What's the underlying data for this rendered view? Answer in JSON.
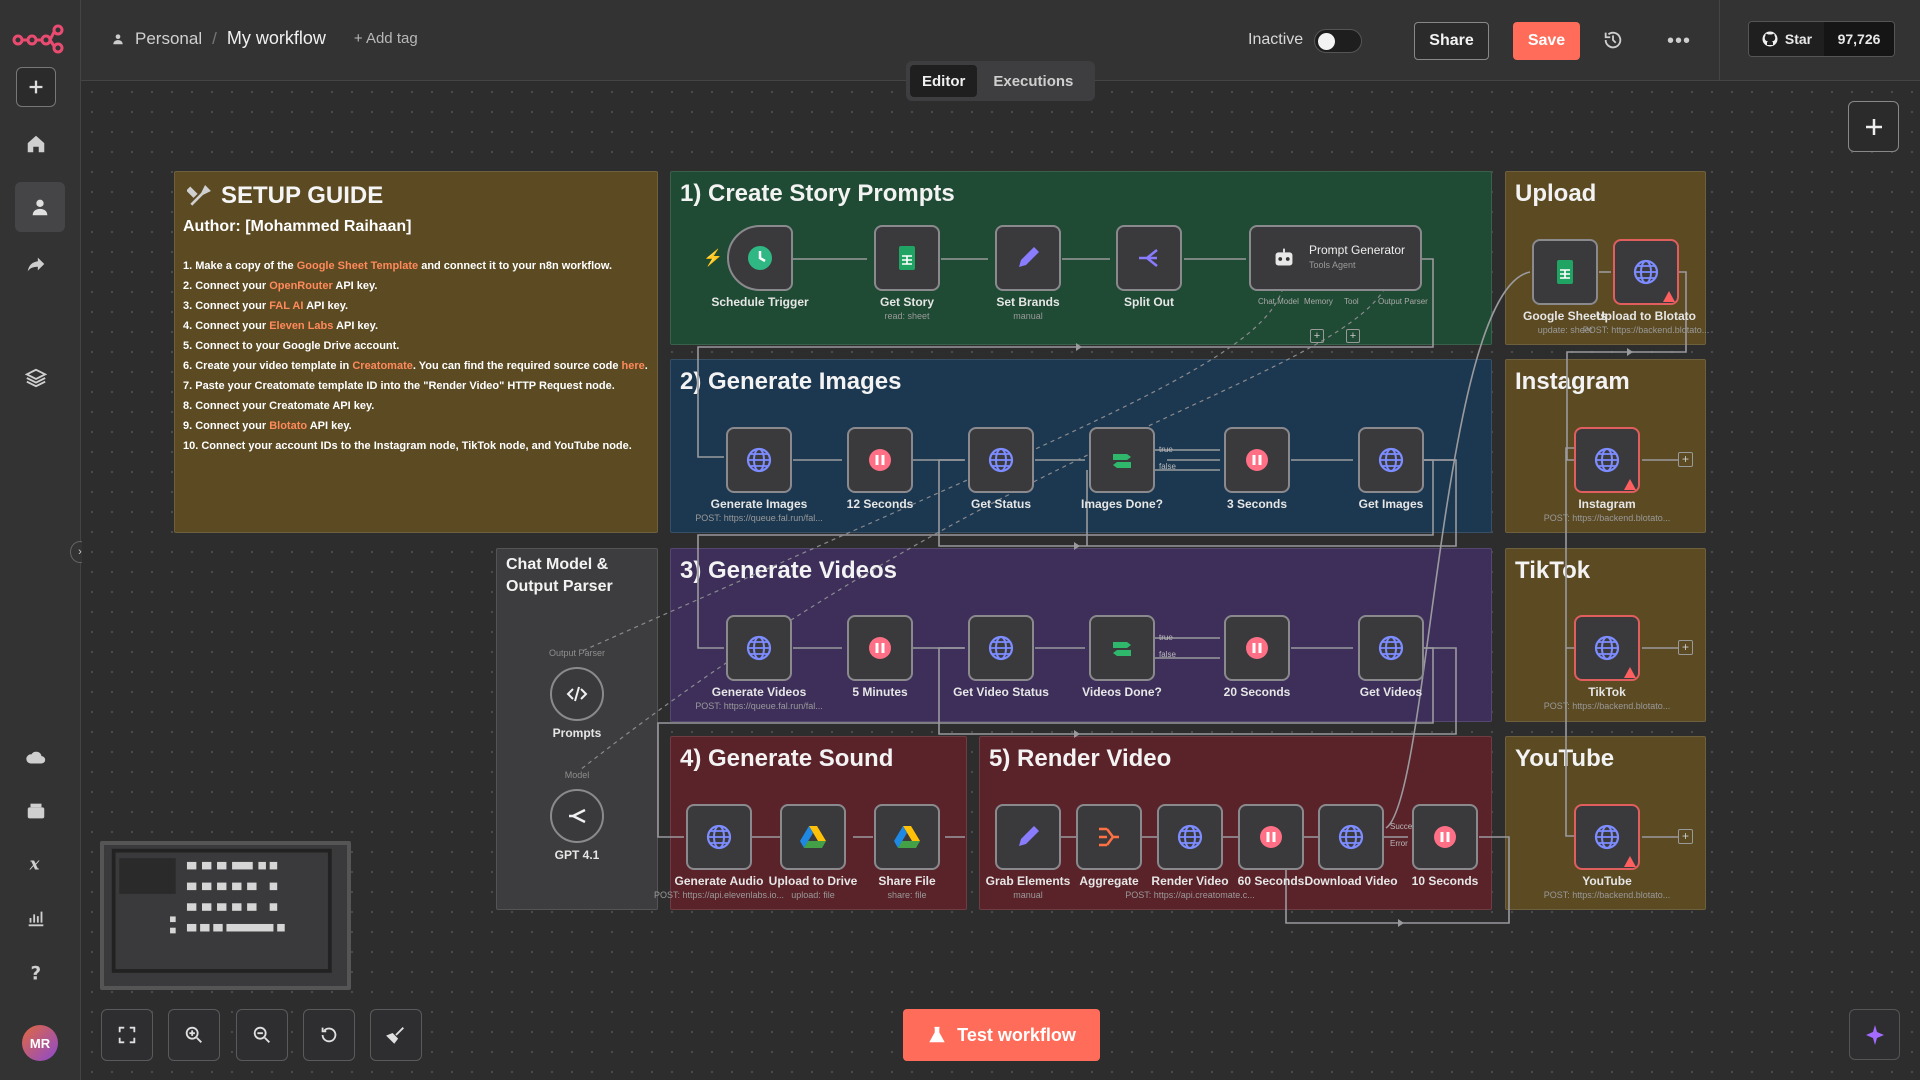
{
  "breadcrumb": {
    "project": "Personal",
    "separator": "/",
    "workflow": "My workflow",
    "add_tag": "+ Add tag"
  },
  "header": {
    "status": "Inactive",
    "share": "Share",
    "save": "Save",
    "github_star": "Star",
    "github_count": "97,726"
  },
  "tabs": {
    "editor": "Editor",
    "executions": "Executions"
  },
  "test_workflow": "Test workflow",
  "avatar": "MR",
  "colors": {
    "save": "#ff6d5a",
    "setup": "#5b4a22",
    "create": "#1f4a33",
    "images": "#1c3850",
    "videos": "#3d2f5a",
    "sound": "#5a2229",
    "upload": "#5b4a22"
  },
  "setup": {
    "title": "SETUP GUIDE",
    "author": "Author: [Mohammed Raihaan]",
    "steps": [
      {
        "a": "1. Make a copy of the ",
        "h": "Google Sheet Template",
        "b": " and connect it to your n8n workflow."
      },
      {
        "a": "2. Connect your ",
        "h": "OpenRouter",
        "b": " API key."
      },
      {
        "a": "3. Connect your ",
        "h": "FAL AI",
        "b": " API key."
      },
      {
        "a": "4. Connect your ",
        "h": "Eleven Labs",
        "b": " API key."
      },
      {
        "a": "5. Connect to your Google Drive account.",
        "h": "",
        "b": ""
      },
      {
        "a": "6. Create your video template in ",
        "h": "Creatomate",
        "b": ". You can find the required source code ",
        "h2": "here",
        "c": "."
      },
      {
        "a": "7. Paste your Creatomate template ID into the \"Render Video\" HTTP Request node.",
        "h": "",
        "b": ""
      },
      {
        "a": "8. Connect your Creatomate API key.",
        "h": "",
        "b": ""
      },
      {
        "a": "9. Connect your ",
        "h": "Blotato",
        "b": " API key."
      },
      {
        "a": "10. Connect your account IDs to the Instagram node, TikTok node, and YouTube node.",
        "h": "",
        "b": ""
      }
    ]
  },
  "groups": {
    "create": "1) Create Story Prompts",
    "images": "2) Generate Images",
    "videos": "3) Generate Videos",
    "sound": "4) Generate Sound",
    "render": "5) Render Video",
    "upload": "Upload",
    "instagram": "Instagram",
    "tiktok": "TikTok",
    "youtube": "YouTube",
    "chat": "Chat Model & Output Parser"
  },
  "nodes": {
    "schedule": {
      "label": "Schedule Trigger"
    },
    "get_story": {
      "label": "Get Story",
      "sub": "read: sheet"
    },
    "set_brands": {
      "label": "Set Brands",
      "sub": "manual"
    },
    "split_out": {
      "label": "Split Out"
    },
    "prompt_gen": {
      "label": "Prompt Generator",
      "sub": "Tools Agent",
      "c1": "Chat Model",
      "c2": "Memory",
      "c3": "Tool",
      "c4": "Output Parser"
    },
    "gen_images": {
      "label": "Generate Images",
      "sub": "POST: https://queue.fal.run/fal..."
    },
    "wait12": {
      "label": "12 Seconds"
    },
    "get_status": {
      "label": "Get Status"
    },
    "images_done": {
      "label": "Images Done?",
      "t": "true",
      "f": "false"
    },
    "wait3": {
      "label": "3 Seconds"
    },
    "get_images": {
      "label": "Get Images"
    },
    "gen_videos": {
      "label": "Generate Videos",
      "sub": "POST: https://queue.fal.run/fal..."
    },
    "wait5m": {
      "label": "5 Minutes"
    },
    "get_video_status": {
      "label": "Get Video Status"
    },
    "videos_done": {
      "label": "Videos Done?",
      "t": "true",
      "f": "false"
    },
    "wait20": {
      "label": "20 Seconds"
    },
    "get_videos": {
      "label": "Get Videos"
    },
    "gen_audio": {
      "label": "Generate Audio",
      "sub": "POST: https://api.elevenlabs.io..."
    },
    "upload_drive": {
      "label": "Upload to Drive",
      "sub": "upload: file"
    },
    "share_file": {
      "label": "Share File",
      "sub": "share: file"
    },
    "grab": {
      "label": "Grab Elements",
      "sub": "manual"
    },
    "aggregate": {
      "label": "Aggregate"
    },
    "render": {
      "label": "Render Video",
      "sub": "POST: https://api.creatomate.c..."
    },
    "wait60": {
      "label": "60 Seconds"
    },
    "download": {
      "label": "Download Video",
      "s": "Success",
      "e": "Error"
    },
    "wait10": {
      "label": "10 Seconds"
    },
    "sheets": {
      "label": "Google Sheets",
      "sub": "update: sheet"
    },
    "blotato": {
      "label": "Upload to Blotato",
      "sub": "POST: https://backend.blotato..."
    },
    "instagram": {
      "label": "Instagram",
      "sub": "POST: https://backend.blotato..."
    },
    "tiktok": {
      "label": "TikTok",
      "sub": "POST: https://backend.blotato..."
    },
    "youtube": {
      "label": "YouTube",
      "sub": "POST: https://backend.blotato..."
    },
    "prompts": {
      "label": "Prompts",
      "top": "Output Parser"
    },
    "gpt": {
      "label": "GPT 4.1",
      "top": "Model"
    }
  }
}
